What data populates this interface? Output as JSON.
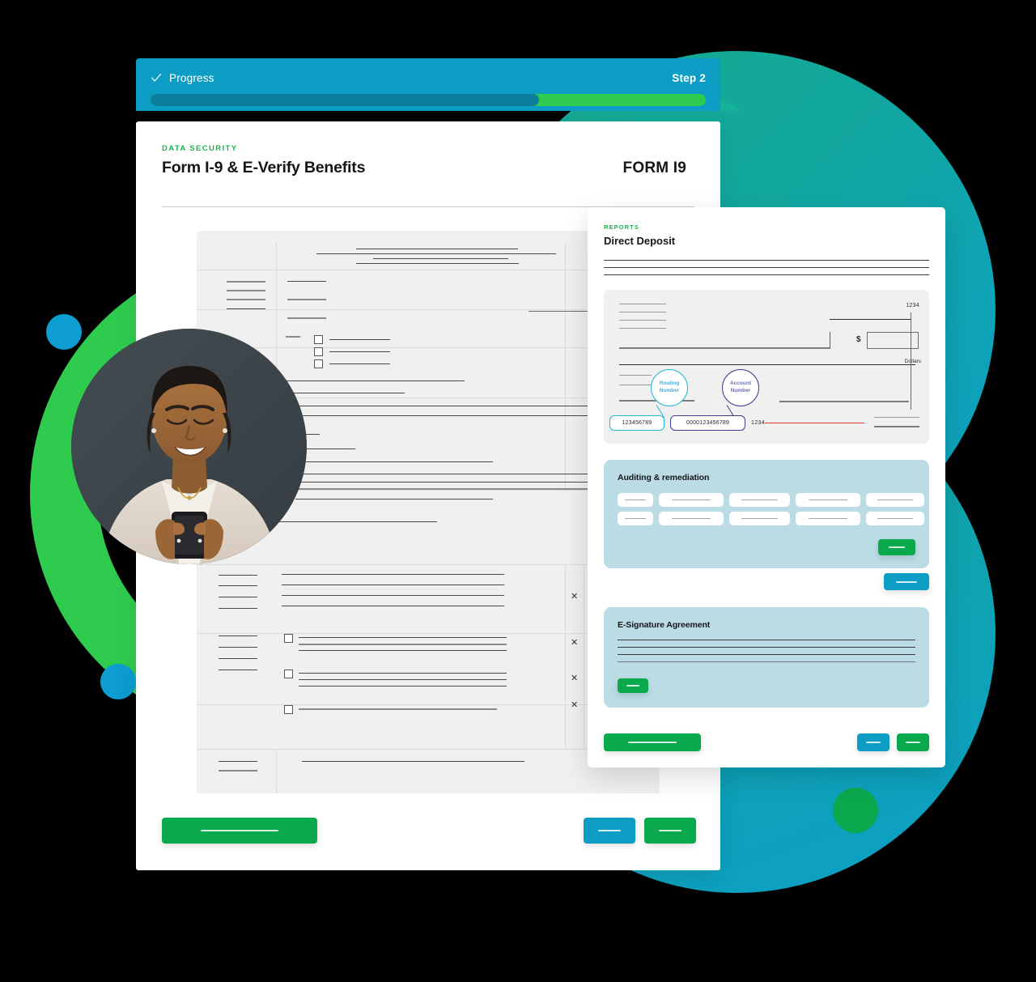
{
  "progress": {
    "check_icon": "check-icon",
    "label": "Progress",
    "step": "Step 2",
    "fill_percent": 70
  },
  "form_document": {
    "eyebrow": "DATA SECURITY",
    "title": "Form I-9 & E-Verify Benefits",
    "tag": "FORM I9",
    "footer": {
      "primary_label": "",
      "secondary_label": "",
      "tertiary_label": ""
    }
  },
  "direct_deposit": {
    "eyebrow": "REPORTS",
    "title": "Direct Deposit",
    "check": {
      "check_number_top": "1234",
      "dollar_symbol": "$",
      "dollars_label": "Dollars",
      "routing_bubble": "Routing\nNumber",
      "routing_bubble_line1": "Routing",
      "routing_bubble_line2": "Number",
      "account_bubble_line1": "Account",
      "account_bubble_line2": "Number",
      "routing_value": "123456789",
      "account_value": "0000123456789",
      "check_number_bottom": "1234"
    },
    "audit_panel": {
      "title": "Auditing & remediation",
      "button_label": ""
    },
    "between_button_label": "",
    "esign_panel": {
      "title": "E-Signature Agreement",
      "button_label": ""
    },
    "footer": {
      "primary_label": "",
      "secondary_label": "",
      "tertiary_label": ""
    }
  },
  "portrait": {
    "alt": "Smiling woman looking at her smartphone"
  },
  "colors": {
    "brand_green": "#0BA94D",
    "bright_green": "#2ECB4E",
    "brand_cyan": "#0D9DC4",
    "teal": "#12A79C",
    "panel_blue": "#BBDCE5",
    "progress_fill": "#0C7E9B",
    "eyebrow_green": "#17B54E",
    "red_accent": "#e0392b",
    "routing_outline": "#23B8D4",
    "account_outline": "#3B3E90"
  }
}
